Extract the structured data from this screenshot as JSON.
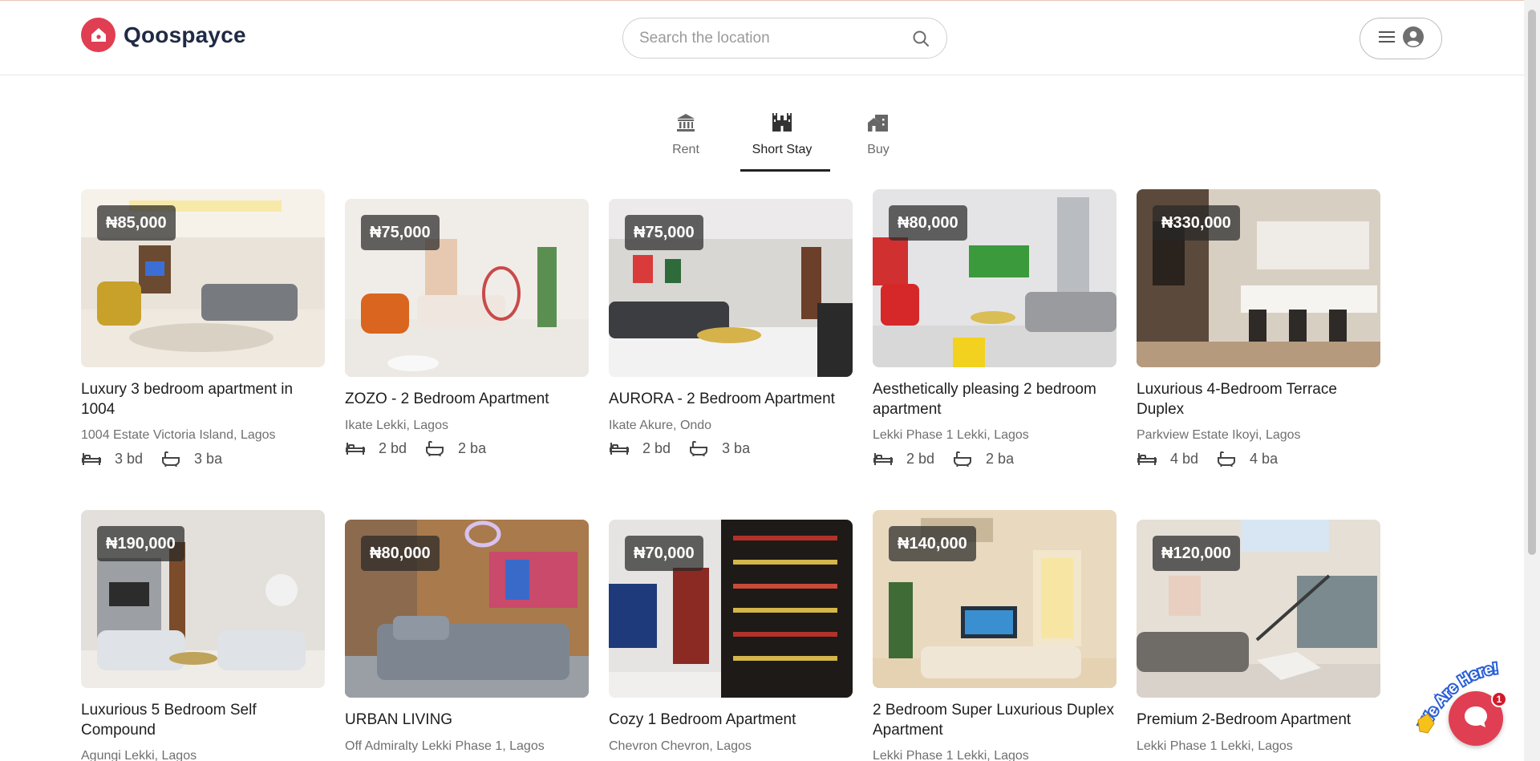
{
  "brand": {
    "name": "Qoospayce",
    "accent": "#e03e52"
  },
  "search": {
    "placeholder": "Search the location"
  },
  "tabs": [
    {
      "label": "Rent",
      "icon": "bank-icon",
      "active": false
    },
    {
      "label": "Short Stay",
      "icon": "castle-icon",
      "active": true
    },
    {
      "label": "Buy",
      "icon": "houses-icon",
      "active": false
    }
  ],
  "listings": [
    {
      "price": "₦85,000",
      "title": "Luxury 3 bedroom apartment in 1004",
      "location": "1004 Estate Victoria Island, Lagos",
      "beds": "3 bd",
      "baths": "3 ba"
    },
    {
      "price": "₦75,000",
      "title": "ZOZO - 2 Bedroom Apartment",
      "location": "Ikate Lekki, Lagos",
      "beds": "2 bd",
      "baths": "2 ba"
    },
    {
      "price": "₦75,000",
      "title": "AURORA - 2 Bedroom Apartment",
      "location": "Ikate Akure, Ondo",
      "beds": "2 bd",
      "baths": "3 ba"
    },
    {
      "price": "₦80,000",
      "title": "Aesthetically pleasing 2 bedroom apartment",
      "location": "Lekki Phase 1 Lekki, Lagos",
      "beds": "2 bd",
      "baths": "2 ba"
    },
    {
      "price": "₦330,000",
      "title": "Luxurious 4-Bedroom Terrace Duplex",
      "location": "Parkview Estate Ikoyi, Lagos",
      "beds": "4 bd",
      "baths": "4 ba"
    },
    {
      "price": "₦190,000",
      "title": "Luxurious 5 Bedroom Self Compound",
      "location": "Agungi Lekki, Lagos"
    },
    {
      "price": "₦80,000",
      "title": "URBAN LIVING",
      "location": "Off Admiralty Lekki Phase 1, Lagos"
    },
    {
      "price": "₦70,000",
      "title": "Cozy 1 Bedroom Apartment",
      "location": "Chevron Chevron, Lagos"
    },
    {
      "price": "₦140,000",
      "title": "2 Bedroom Super Luxurious Duplex Apartment",
      "location": "Lekki Phase 1 Lekki, Lagos"
    },
    {
      "price": "₦120,000",
      "title": "Premium 2-Bedroom Apartment",
      "location": "Lekki Phase 1 Lekki, Lagos"
    }
  ],
  "chat": {
    "sticker_text": "We Are Here!",
    "badge": "1"
  }
}
